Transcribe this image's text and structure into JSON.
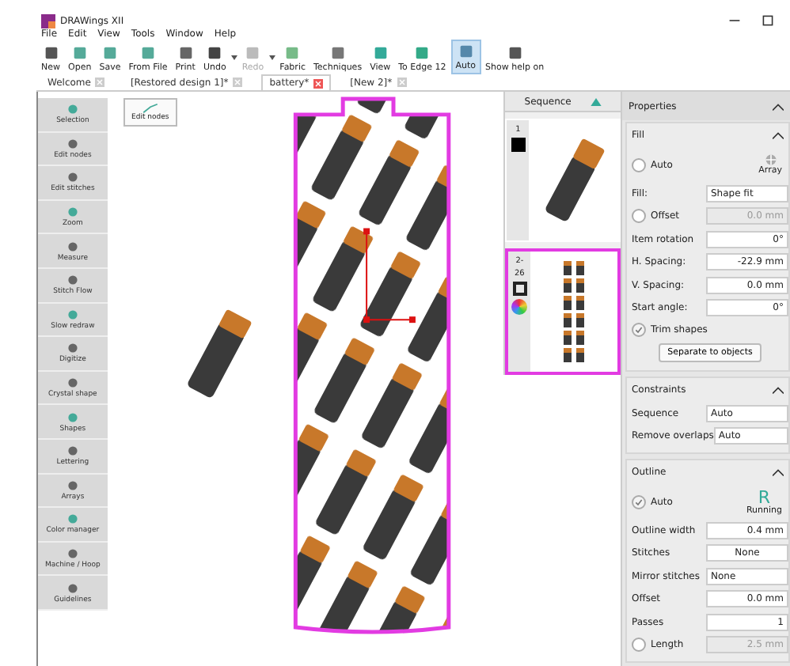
{
  "window": {
    "title": "DRAWings XII"
  },
  "menu": [
    "File",
    "Edit",
    "View",
    "Tools",
    "Window",
    "Help"
  ],
  "toolbar": [
    {
      "label": "New",
      "disabled": false,
      "selected": false,
      "dropdown": false
    },
    {
      "label": "Open",
      "disabled": false,
      "selected": false,
      "dropdown": false
    },
    {
      "label": "Save",
      "disabled": false,
      "selected": false,
      "dropdown": false
    },
    {
      "label": "From File",
      "disabled": false,
      "selected": false,
      "dropdown": false
    },
    {
      "label": "Print",
      "disabled": false,
      "selected": false,
      "dropdown": false
    },
    {
      "label": "Undo",
      "disabled": false,
      "selected": false,
      "dropdown": true
    },
    {
      "label": "Redo",
      "disabled": true,
      "selected": false,
      "dropdown": true
    },
    {
      "label": "Fabric",
      "disabled": false,
      "selected": false,
      "dropdown": false
    },
    {
      "label": "Techniques",
      "disabled": false,
      "selected": false,
      "dropdown": false
    },
    {
      "label": "View",
      "disabled": false,
      "selected": false,
      "dropdown": false
    },
    {
      "label": "To Edge 12",
      "disabled": false,
      "selected": false,
      "dropdown": false
    },
    {
      "label": "Auto",
      "disabled": false,
      "selected": true,
      "dropdown": false
    },
    {
      "label": "Show help on",
      "disabled": false,
      "selected": false,
      "dropdown": false
    }
  ],
  "tabs": [
    {
      "label": "Welcome",
      "selected": false
    },
    {
      "label": "[Restored design 1]*",
      "selected": false
    },
    {
      "label": "battery*",
      "selected": true
    },
    {
      "label": "[New 2]*",
      "selected": false
    }
  ],
  "toolbox": {
    "items": [
      "Selection",
      "Edit nodes",
      "Edit stitches",
      "Zoom",
      "Measure",
      "Stitch Flow",
      "Slow redraw",
      "Digitize",
      "Crystal shape",
      "Shapes",
      "Lettering",
      "Arrays",
      "Color manager",
      "Machine / Hoop",
      "Guidelines"
    ],
    "tooltip": "Edit nodes"
  },
  "sequence": {
    "title": "Sequence",
    "items": [
      {
        "lines": [
          "1"
        ],
        "selected": false,
        "kind": "fill"
      },
      {
        "lines": [
          "2-",
          "26"
        ],
        "selected": true,
        "kind": "outline"
      }
    ]
  },
  "properties": {
    "title": "Properties",
    "fill": {
      "title": "Fill",
      "auto": {
        "label": "Auto",
        "checked": false
      },
      "stitch_type": "Array",
      "rows": [
        {
          "kind": "select",
          "label": "Fill:",
          "value": "Shape fit"
        },
        {
          "kind": "check",
          "label": "Offset",
          "checked": false,
          "value": "0.0 mm"
        },
        {
          "kind": "number",
          "label": "Item rotation",
          "value": "0°"
        },
        {
          "kind": "number",
          "label": "H. Spacing:",
          "value": "-22.9 mm"
        },
        {
          "kind": "number",
          "label": "V. Spacing:",
          "value": "0.0 mm"
        },
        {
          "kind": "number",
          "label": "Start angle:",
          "value": "0°"
        }
      ],
      "trim": {
        "label": "Trim shapes",
        "checked": true
      },
      "button": "Separate to objects"
    },
    "constraints": {
      "title": "Constraints",
      "rows": [
        {
          "kind": "select",
          "label": "Sequence",
          "value": "Auto"
        },
        {
          "kind": "select",
          "label": "Remove overlaps",
          "value": "Auto"
        }
      ]
    },
    "outline": {
      "title": "Outline",
      "auto": {
        "label": "Auto",
        "checked": true
      },
      "stitch_letter": "R",
      "stitch_type": "Running",
      "rows": [
        {
          "kind": "number",
          "label": "Outline width",
          "value": "0.4 mm"
        },
        {
          "kind": "center",
          "label": "Stitches",
          "value": "None"
        },
        {
          "kind": "select",
          "label": "Mirror stitches",
          "value": "None"
        },
        {
          "kind": "number",
          "label": "Offset",
          "value": "0.0 mm"
        },
        {
          "kind": "number",
          "label": "Passes",
          "value": "1"
        },
        {
          "kind": "check",
          "label": "Length",
          "checked": false,
          "value": "2.5 mm"
        }
      ]
    }
  }
}
